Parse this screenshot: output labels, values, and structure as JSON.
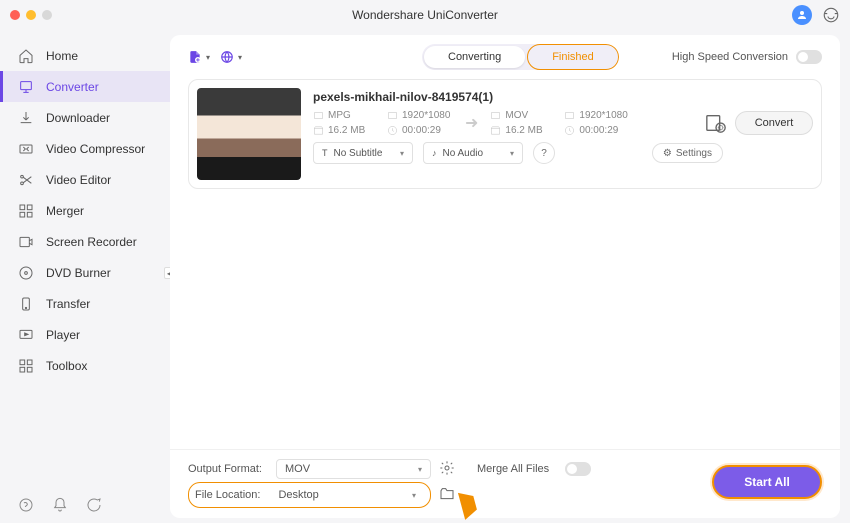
{
  "app_title": "Wondershare UniConverter",
  "sidebar": {
    "items": [
      {
        "label": "Home"
      },
      {
        "label": "Converter"
      },
      {
        "label": "Downloader"
      },
      {
        "label": "Video Compressor"
      },
      {
        "label": "Video Editor"
      },
      {
        "label": "Merger"
      },
      {
        "label": "Screen Recorder"
      },
      {
        "label": "DVD Burner"
      },
      {
        "label": "Transfer"
      },
      {
        "label": "Player"
      },
      {
        "label": "Toolbox"
      }
    ]
  },
  "toolbar": {
    "tabs": {
      "converting": "Converting",
      "finished": "Finished"
    },
    "high_speed_label": "High Speed Conversion"
  },
  "file": {
    "name": "pexels-mikhail-nilov-8419574(1)",
    "src": {
      "format": "MPG",
      "resolution": "1920*1080",
      "size": "16.2 MB",
      "duration": "00:00:29"
    },
    "dst": {
      "format": "MOV",
      "resolution": "1920*1080",
      "size": "16.2 MB",
      "duration": "00:00:29"
    },
    "subtitle": "No Subtitle",
    "audio": "No Audio",
    "settings_label": "Settings",
    "convert_label": "Convert"
  },
  "bottom": {
    "output_format_label": "Output Format:",
    "output_format_value": "MOV",
    "file_location_label": "File Location:",
    "file_location_value": "Desktop",
    "merge_label": "Merge All Files",
    "start_label": "Start All"
  }
}
